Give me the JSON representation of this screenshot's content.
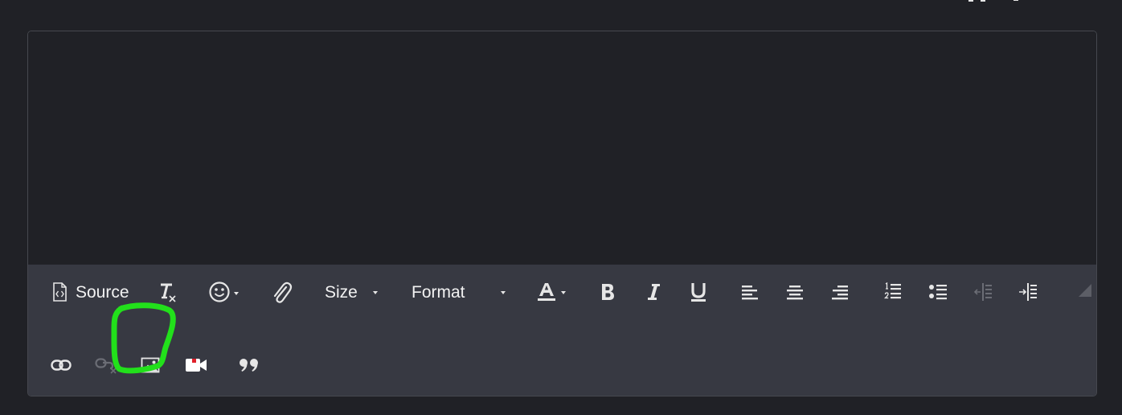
{
  "toolbar": {
    "source_label": "Source",
    "size_label": "Size",
    "format_label": "Format"
  },
  "icons": {
    "source": "source-icon",
    "remove_format": "remove-format-icon",
    "emoji": "emoji-icon",
    "attachment": "paperclip-icon",
    "text_color": "text-color-icon",
    "bold": "bold-icon",
    "italic": "italic-icon",
    "underline": "underline-icon",
    "align_left": "align-left-icon",
    "align_center": "align-center-icon",
    "align_right": "align-right-icon",
    "numbered_list": "numbered-list-icon",
    "bulleted_list": "bulleted-list-icon",
    "outdent": "outdent-icon",
    "indent": "indent-icon",
    "link": "link-icon",
    "unlink": "unlink-icon",
    "image": "image-icon",
    "video": "video-icon",
    "blockquote": "blockquote-icon",
    "resize": "resize-grip-icon"
  },
  "colors": {
    "page_background": "#202126",
    "toolbar_background": "#373942",
    "border": "#46484f",
    "icon": "#e6e6e6",
    "icon_disabled": "#6b6d75",
    "highlight": "#22e01b",
    "video_accent": "#e0202a"
  },
  "annotation": {
    "shape": "hand-drawn circle",
    "target": "image-button"
  }
}
